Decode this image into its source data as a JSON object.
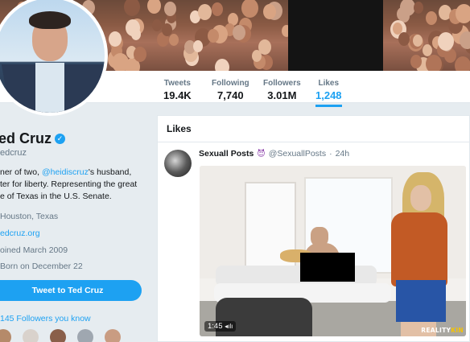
{
  "stats": [
    {
      "label": "Tweets",
      "value": "19.4K"
    },
    {
      "label": "Following",
      "value": "7,740"
    },
    {
      "label": "Followers",
      "value": "3.01M"
    },
    {
      "label": "Likes",
      "value": "1,248"
    }
  ],
  "profile": {
    "name": "ed Cruz",
    "handle": "edcruz",
    "bio_prefix": "ner of two, ",
    "bio_mention": "@heidiscruz",
    "bio_line1_suffix": "'s husband,",
    "bio_line2": "ter for liberty. Representing the great",
    "bio_line3": "e of Texas in the U.S. Senate.",
    "location": "Houston, Texas",
    "website": "edcruz.org",
    "joined": "oined March 2009",
    "born": "Born on December 22",
    "tweet_button": "Tweet to Ted Cruz",
    "followers_you_know": "145 Followers you know"
  },
  "likes_section": {
    "title": "Likes"
  },
  "tweet": {
    "author_name": "Sexuall Posts",
    "author_emoji": "😈",
    "author_handle": "@SexuallPosts",
    "separator": "·",
    "time": "24h",
    "video_duration": "1:45",
    "watermark_left": "REALITY",
    "watermark_right": "KIN"
  },
  "colors": {
    "accent": "#1da1f2",
    "background": "#e6ecf0"
  }
}
